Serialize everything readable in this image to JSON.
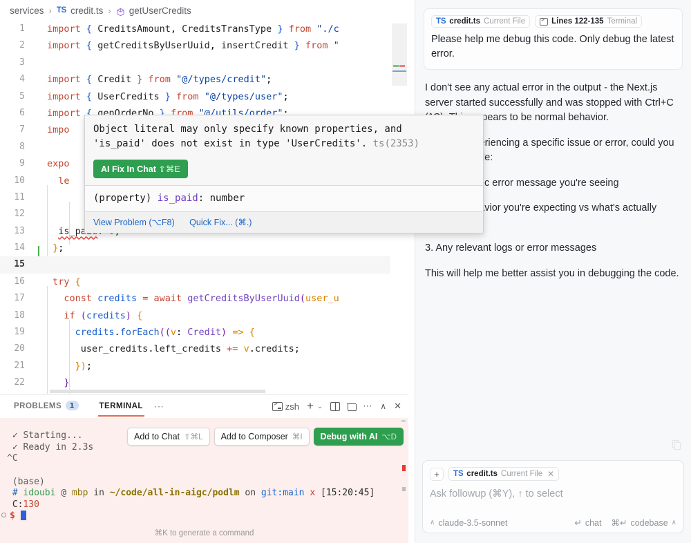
{
  "breadcrumb": {
    "folder": "services",
    "file": "credit.ts",
    "symbol": "getUserCredits",
    "ts_badge": "TS",
    "separator": "›"
  },
  "editor": {
    "lines": [
      {
        "n": "1",
        "current": false
      },
      {
        "n": "2",
        "current": false
      },
      {
        "n": "3",
        "current": false
      },
      {
        "n": "4",
        "current": false
      },
      {
        "n": "5",
        "current": false
      },
      {
        "n": "6",
        "current": false
      },
      {
        "n": "7",
        "current": false
      },
      {
        "n": "8",
        "current": false
      },
      {
        "n": "9",
        "current": false
      },
      {
        "n": "10",
        "current": false
      },
      {
        "n": "11",
        "current": false
      },
      {
        "n": "12",
        "current": false
      },
      {
        "n": "13",
        "current": false
      },
      {
        "n": "14",
        "current": false
      },
      {
        "n": "15",
        "current": true
      },
      {
        "n": "16",
        "current": false
      },
      {
        "n": "17",
        "current": false
      },
      {
        "n": "18",
        "current": false
      },
      {
        "n": "19",
        "current": false
      },
      {
        "n": "20",
        "current": false
      },
      {
        "n": "21",
        "current": false
      },
      {
        "n": "22",
        "current": false
      }
    ],
    "source": [
      "import { CreditsAmount, CreditsTransType } from \"./co",
      "import { getCreditsByUserUuid, insertCredit } from \"@",
      "",
      "import { Credit } from \"@/types/credit\";",
      "import { UserCredits } from \"@/types/user\";",
      "import { genOrderNo } from \"@/utils/order\";",
      "import",
      "",
      "expo",
      "  le",
      "",
      "",
      "  is_paid: 0,",
      "};",
      "",
      "  try {",
      "    const credits = await getCreditsByUserUuid(user_u",
      "    if (credits) {",
      "      credits.forEach((v: Credit) => {",
      "        user_credits.left_credits += v.credits;",
      "      });",
      "    }"
    ]
  },
  "hover_popup": {
    "message_line1": "Object literal may only specify known properties, and",
    "message_line2": "'is_paid' does not exist in type 'UserCredits'.",
    "error_code": "ts(2353)",
    "ai_fix_label": "AI Fix In Chat",
    "ai_fix_shortcut": "⇧⌘E",
    "signature_prefix": "(property)",
    "signature_name": "is_paid",
    "signature_type": ": number",
    "action_view_problem": "View Problem (⌥F8)",
    "action_quick_fix": "Quick Fix... (⌘.)",
    "accent_green": "#2e9e4f",
    "link_blue": "#1a66c9"
  },
  "panel": {
    "tabs": [
      {
        "label": "PROBLEMS",
        "badge": "1",
        "active": false
      },
      {
        "label": "TERMINAL",
        "badge": "",
        "active": true
      }
    ],
    "overflow": "⋯",
    "actions": {
      "shell_name": "zsh",
      "new_label": "+",
      "chevron": "⌄",
      "more": "⋯",
      "collapse": "∧",
      "close": "✕"
    },
    "floating_buttons": [
      {
        "label": "Add to Chat",
        "shortcut": "⇧⌘L",
        "primary": false
      },
      {
        "label": "Add to Composer",
        "shortcut": "⌘I",
        "primary": false
      },
      {
        "label": "Debug with AI",
        "shortcut": "⌥D",
        "primary": true
      }
    ],
    "terminal": {
      "line_starting": "Starting...",
      "line_ready": "Ready in 2.3s",
      "check": "✓",
      "line_ctrlc": "^C",
      "line_base": "(base)",
      "prompt_hash": "#",
      "prompt_user": "idoubi",
      "prompt_at": "@",
      "prompt_host": "mbp",
      "prompt_in": "in",
      "prompt_path": "~/code/all-in-aigc/podlm",
      "prompt_on": "on",
      "prompt_git": "git:main",
      "prompt_dirty": "x",
      "prompt_time": "[15:20:45]",
      "exit_label": "C:",
      "exit_code": "130",
      "prompt_symbol": "$",
      "hint": "⌘K to generate a command"
    }
  },
  "chat": {
    "user_message": {
      "pills": [
        {
          "icon": "ts-icon",
          "name": "credit.ts",
          "meta": "Current File"
        },
        {
          "icon": "terminal-icon",
          "name": "Lines 122-135",
          "meta": "Terminal"
        }
      ],
      "text": "Please help me debug this code. Only debug the latest error."
    },
    "assistant_message": {
      "paragraphs": [
        "I don't see any actual error in the output - the Next.js server started successfully and was stopped with Ctrl+C (^C). This appears to be normal behavior.",
        "If you're experiencing a specific issue or error, could you please provide:",
        "1. The specific error message you're seeing",
        "2. What behavior you're expecting vs what's actually happening",
        "3. Any relevant logs or error messages",
        "This will help me better assist you in debugging the code."
      ]
    },
    "input": {
      "add_button": "+",
      "pill": {
        "icon": "ts-icon",
        "name": "credit.ts",
        "meta": "Current File",
        "close": "✕"
      },
      "placeholder": "Ask followup (⌘Y), ↑ to select",
      "model": "claude-3.5-sonnet",
      "model_chevron": "∧",
      "send_mode": "chat",
      "send_icon": "↵",
      "codebase_label": "codebase",
      "codebase_shortcut": "⌘↵",
      "codebase_chevron": "∧"
    }
  }
}
